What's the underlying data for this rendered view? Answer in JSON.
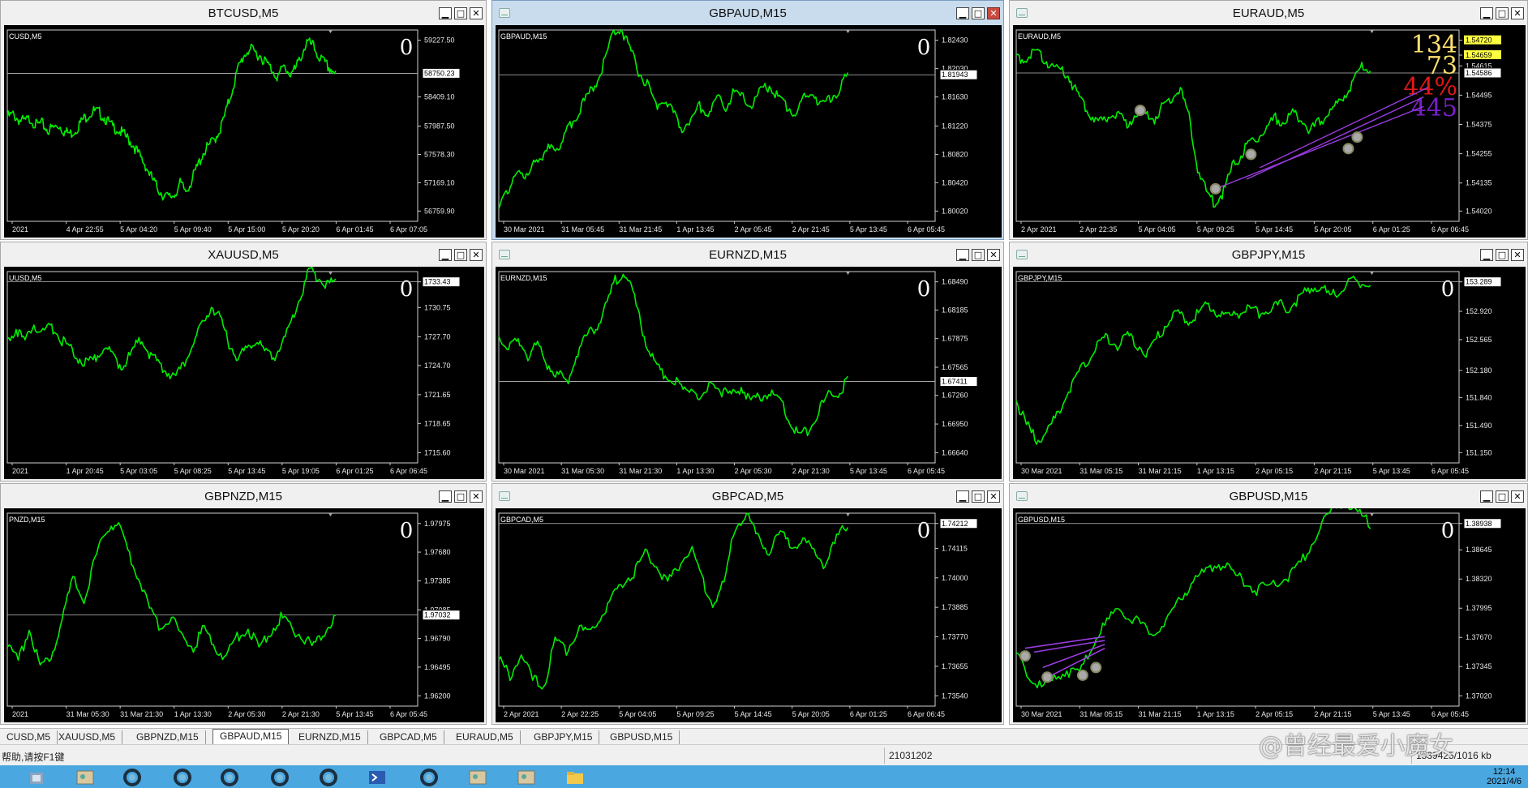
{
  "colors": {
    "chart_bg": "#000000",
    "price_line": "#00ee00",
    "accent": "#c9dced",
    "purple": "#9a3ce0",
    "overlay_yellow": "#ffe070",
    "overlay_red": "#e01818",
    "overlay_purple": "#7a1ec8",
    "taskbar": "#4aa7e0"
  },
  "windows": [
    {
      "title": "BTCUSD,M5",
      "subtitle": "CUSD,M5",
      "counter": "0",
      "price_tag": "58750.23",
      "price_labels": [
        "59227.50",
        "58409.10",
        "57987.50",
        "57578.30",
        "57169.10",
        "56759.90"
      ],
      "time_labels": [
        "2021",
        "4 Apr 22:55",
        "5 Apr 04:20",
        "5 Apr 09:40",
        "5 Apr 15:00",
        "5 Apr 20:20",
        "6 Apr 01:45",
        "6 Apr 07:05"
      ],
      "series": [
        58120,
        58150,
        58080,
        58050,
        58100,
        58000,
        58020,
        57930,
        57960,
        58000,
        57900,
        57880,
        57950,
        58070,
        58150,
        58200,
        58180,
        58100,
        57990,
        57950,
        57880,
        57800,
        57700,
        57550,
        57420,
        57250,
        57100,
        57000,
        56950,
        57000,
        57150,
        57050,
        57200,
        57400,
        57600,
        57700,
        57800,
        57950,
        58200,
        58500,
        58800,
        59000,
        59100,
        59050,
        59000,
        58900,
        58800,
        58700,
        58850,
        58750,
        58800,
        59000,
        59200,
        59150,
        59000,
        58900,
        58820,
        58760
      ],
      "hline": 58750
    },
    {
      "title": "GBPAUD,M15",
      "subtitle": "GBPAUD,M15",
      "counter": "0",
      "price_tag": "1.81943",
      "price_labels": [
        "1.82430",
        "1.82030",
        "1.81630",
        "1.81220",
        "1.80820",
        "1.80420",
        "1.80020"
      ],
      "time_labels": [
        "30 Mar 2021",
        "31 Mar 05:45",
        "31 Mar 21:45",
        "1 Apr 13:45",
        "2 Apr 05:45",
        "2 Apr 21:45",
        "5 Apr 13:45",
        "6 Apr 05:45"
      ],
      "series": [
        1.8005,
        1.803,
        1.806,
        1.8045,
        1.808,
        1.807,
        1.81,
        1.809,
        1.812,
        1.814,
        1.816,
        1.818,
        1.821,
        1.825,
        1.826,
        1.823,
        1.82,
        1.818,
        1.815,
        1.816,
        1.814,
        1.812,
        1.813,
        1.815,
        1.814,
        1.816,
        1.815,
        1.817,
        1.816,
        1.815,
        1.817,
        1.818,
        1.816,
        1.815,
        1.814,
        1.816,
        1.817,
        1.815,
        1.816,
        1.8175,
        1.8194
      ],
      "hline": 1.81943
    },
    {
      "title": "EURAUD,M5",
      "subtitle": "EURAUD,M5",
      "counter": "",
      "price_tag": "1.54586",
      "price_labels": [
        "1.54720",
        "1.54659",
        "1.54615",
        "1.54495",
        "1.54375",
        "1.54255",
        "1.54135",
        "1.54020"
      ],
      "price_highlight": [
        "1.54720",
        "1.54659"
      ],
      "time_labels": [
        "2 Apr 2021",
        "2 Apr 22:35",
        "5 Apr 04:05",
        "5 Apr 09:25",
        "5 Apr 14:45",
        "5 Apr 20:05",
        "6 Apr 01:25",
        "6 Apr 06:45"
      ],
      "series": [
        1.5466,
        1.5464,
        1.5467,
        1.5465,
        1.5462,
        1.546,
        1.5458,
        1.545,
        1.5445,
        1.544,
        1.5438,
        1.5442,
        1.544,
        1.5438,
        1.5443,
        1.5441,
        1.544,
        1.5445,
        1.5448,
        1.5452,
        1.544,
        1.542,
        1.541,
        1.5405,
        1.541,
        1.542,
        1.5425,
        1.543,
        1.5432,
        1.5436,
        1.544,
        1.5438,
        1.5442,
        1.544,
        1.5435,
        1.5438,
        1.5442,
        1.5445,
        1.545,
        1.5455,
        1.5462,
        1.546
      ],
      "hline": 1.54586,
      "overlay": [
        {
          "text": "134",
          "color": "#ffe070"
        },
        {
          "text": "73",
          "color": "#ffe070"
        },
        {
          "text": "44%",
          "color": "#e01818"
        },
        {
          "text": "445",
          "color": "#7a1ec8"
        }
      ]
    },
    {
      "title": "XAUUSD,M5",
      "subtitle": "UUSD,M5",
      "counter": "0",
      "price_tag": "1733.43",
      "price_labels": [
        "1733.43",
        "1730.75",
        "1727.70",
        "1724.70",
        "1721.65",
        "1718.65",
        "1715.60"
      ],
      "time_labels": [
        "2021",
        "1 Apr 20:45",
        "5 Apr 03:05",
        "5 Apr 08:25",
        "5 Apr 13:45",
        "5 Apr 19:05",
        "6 Apr 01:25",
        "6 Apr 06:45"
      ],
      "series": [
        1727.5,
        1728.5,
        1727.2,
        1729.0,
        1728.0,
        1728.8,
        1727.5,
        1726.5,
        1725.5,
        1724.8,
        1725.5,
        1726.8,
        1725.5,
        1724.5,
        1726.0,
        1727.5,
        1726.0,
        1725.0,
        1724.0,
        1723.5,
        1725.0,
        1727.0,
        1729.0,
        1731.0,
        1729.5,
        1727.0,
        1725.5,
        1726.5,
        1727.5,
        1726.0,
        1725.5,
        1727.0,
        1729.0,
        1732.0,
        1734.5,
        1734.0,
        1733.0,
        1733.43
      ],
      "hline": 1733.43
    },
    {
      "title": "EURNZD,M15",
      "subtitle": "EURNZD,M15",
      "counter": "0",
      "price_tag": "1.67411",
      "price_labels": [
        "1.68490",
        "1.68185",
        "1.67875",
        "1.67565",
        "1.67260",
        "1.66950",
        "1.66640"
      ],
      "time_labels": [
        "30 Mar 2021",
        "31 Mar 05:30",
        "31 Mar 21:30",
        "1 Apr 13:30",
        "2 Apr 05:30",
        "2 Apr 21:30",
        "5 Apr 13:45",
        "6 Apr 05:45"
      ],
      "series": [
        1.679,
        1.6775,
        1.6785,
        1.677,
        1.678,
        1.676,
        1.675,
        1.674,
        1.677,
        1.679,
        1.68,
        1.682,
        1.685,
        1.686,
        1.683,
        1.679,
        1.676,
        1.675,
        1.6745,
        1.673,
        1.6735,
        1.672,
        1.674,
        1.673,
        1.6725,
        1.6735,
        1.672,
        1.6725,
        1.673,
        1.672,
        1.67,
        1.668,
        1.669,
        1.671,
        1.6725,
        1.673,
        1.6741
      ],
      "hline": 1.67411
    },
    {
      "title": "GBPJPY,M15",
      "subtitle": "GBPJPY,M15",
      "counter": "0",
      "price_tag": "153.289",
      "price_labels": [
        "153.289",
        "152.920",
        "152.565",
        "152.180",
        "151.840",
        "151.490",
        "151.150"
      ],
      "time_labels": [
        "30 Mar 2021",
        "31 Mar 05:15",
        "31 Mar 21:15",
        "1 Apr 13:15",
        "2 Apr 05:15",
        "2 Apr 21:15",
        "5 Apr 13:45",
        "6 Apr 05:45"
      ],
      "series": [
        151.8,
        151.5,
        151.3,
        151.4,
        151.6,
        151.9,
        152.1,
        152.3,
        152.5,
        152.6,
        152.5,
        152.6,
        152.5,
        152.4,
        152.6,
        152.8,
        152.9,
        152.8,
        152.9,
        153.0,
        152.9,
        152.85,
        152.9,
        152.95,
        152.9,
        152.95,
        153.0,
        152.95,
        153.1,
        153.2,
        153.25,
        153.1,
        153.2,
        153.3,
        153.25,
        153.289
      ],
      "hline": 153.289
    },
    {
      "title": "GBPNZD,M15",
      "subtitle": "PNZD,M15",
      "counter": "0",
      "price_tag": "1.97032",
      "price_labels": [
        "1.97975",
        "1.97680",
        "1.97385",
        "1.97085",
        "1.96790",
        "1.96495",
        "1.96200"
      ],
      "time_labels": [
        "2021",
        "31 Mar 05:30",
        "31 Mar 21:30",
        "1 Apr 13:30",
        "2 Apr 05:30",
        "2 Apr 21:30",
        "5 Apr 13:45",
        "6 Apr 05:45"
      ],
      "series": [
        1.967,
        1.9655,
        1.969,
        1.965,
        1.966,
        1.97,
        1.974,
        1.972,
        1.976,
        1.979,
        1.98,
        1.977,
        1.974,
        1.971,
        1.969,
        1.97,
        1.968,
        1.967,
        1.969,
        1.967,
        1.966,
        1.968,
        1.969,
        1.967,
        1.9685,
        1.97,
        1.969,
        1.968,
        1.967,
        1.9685,
        1.9703
      ],
      "hline": 1.97032
    },
    {
      "title": "GBPCAD,M5",
      "subtitle": "GBPCAD,M5",
      "counter": "0",
      "price_tag": "1.74212",
      "price_labels": [
        "1.74212",
        "1.74115",
        "1.74000",
        "1.73885",
        "1.73770",
        "1.73655",
        "1.73540"
      ],
      "time_labels": [
        "2 Apr 2021",
        "2 Apr 22:25",
        "5 Apr 04:05",
        "5 Apr 09:25",
        "5 Apr 14:45",
        "5 Apr 20:05",
        "6 Apr 01:25",
        "6 Apr 06:45"
      ],
      "series": [
        1.7368,
        1.7362,
        1.737,
        1.736,
        1.7358,
        1.7375,
        1.7372,
        1.738,
        1.7378,
        1.7385,
        1.7392,
        1.7398,
        1.7402,
        1.741,
        1.7405,
        1.7398,
        1.7405,
        1.7412,
        1.74,
        1.739,
        1.7398,
        1.742,
        1.7425,
        1.7415,
        1.741,
        1.7418,
        1.7412,
        1.7415,
        1.741,
        1.7405,
        1.7415,
        1.7421
      ],
      "hline": 1.74212
    },
    {
      "title": "GBPUSD,M15",
      "subtitle": "GBPUSD,M15",
      "counter": "0",
      "price_tag": "1.38938",
      "price_labels": [
        "1.38938",
        "1.38645",
        "1.38320",
        "1.37995",
        "1.37670",
        "1.37345",
        "1.37020"
      ],
      "time_labels": [
        "30 Mar 2021",
        "31 Mar 05:15",
        "31 Mar 21:15",
        "1 Apr 13:15",
        "2 Apr 05:15",
        "2 Apr 21:15",
        "5 Apr 13:45",
        "6 Apr 05:45"
      ],
      "series": [
        1.375,
        1.3725,
        1.371,
        1.372,
        1.373,
        1.3725,
        1.376,
        1.378,
        1.38,
        1.379,
        1.378,
        1.377,
        1.379,
        1.381,
        1.383,
        1.384,
        1.385,
        1.384,
        1.383,
        1.382,
        1.3825,
        1.383,
        1.384,
        1.386,
        1.389,
        1.391,
        1.392,
        1.3905,
        1.3894
      ],
      "hline": 1.38938
    }
  ],
  "tabs": [
    "CUSD,M5",
    "XAUUSD,M5",
    "GBPNZD,M15",
    "GBPAUD,M15",
    "EURNZD,M15",
    "GBPCAD,M5",
    "EURAUD,M5",
    "GBPJPY,M15",
    "GBPUSD,M15"
  ],
  "active_tab": "GBPAUD,M15",
  "status": {
    "help": "帮助,请按F1键",
    "build": "21031202",
    "traffic": "1539425/1016 kb"
  },
  "watermark": "@曾经最爱小魔女",
  "tray": {
    "time": "12:14",
    "date": "2021/4/6"
  },
  "taskbar_icons": [
    "tool-icon",
    "image-editor-icon",
    "terminal-icon",
    "terminal-icon",
    "terminal-icon",
    "terminal-icon",
    "terminal-icon",
    "powershell-icon",
    "terminal-icon",
    "image-editor-icon",
    "image-editor-icon",
    "folder-icon"
  ]
}
